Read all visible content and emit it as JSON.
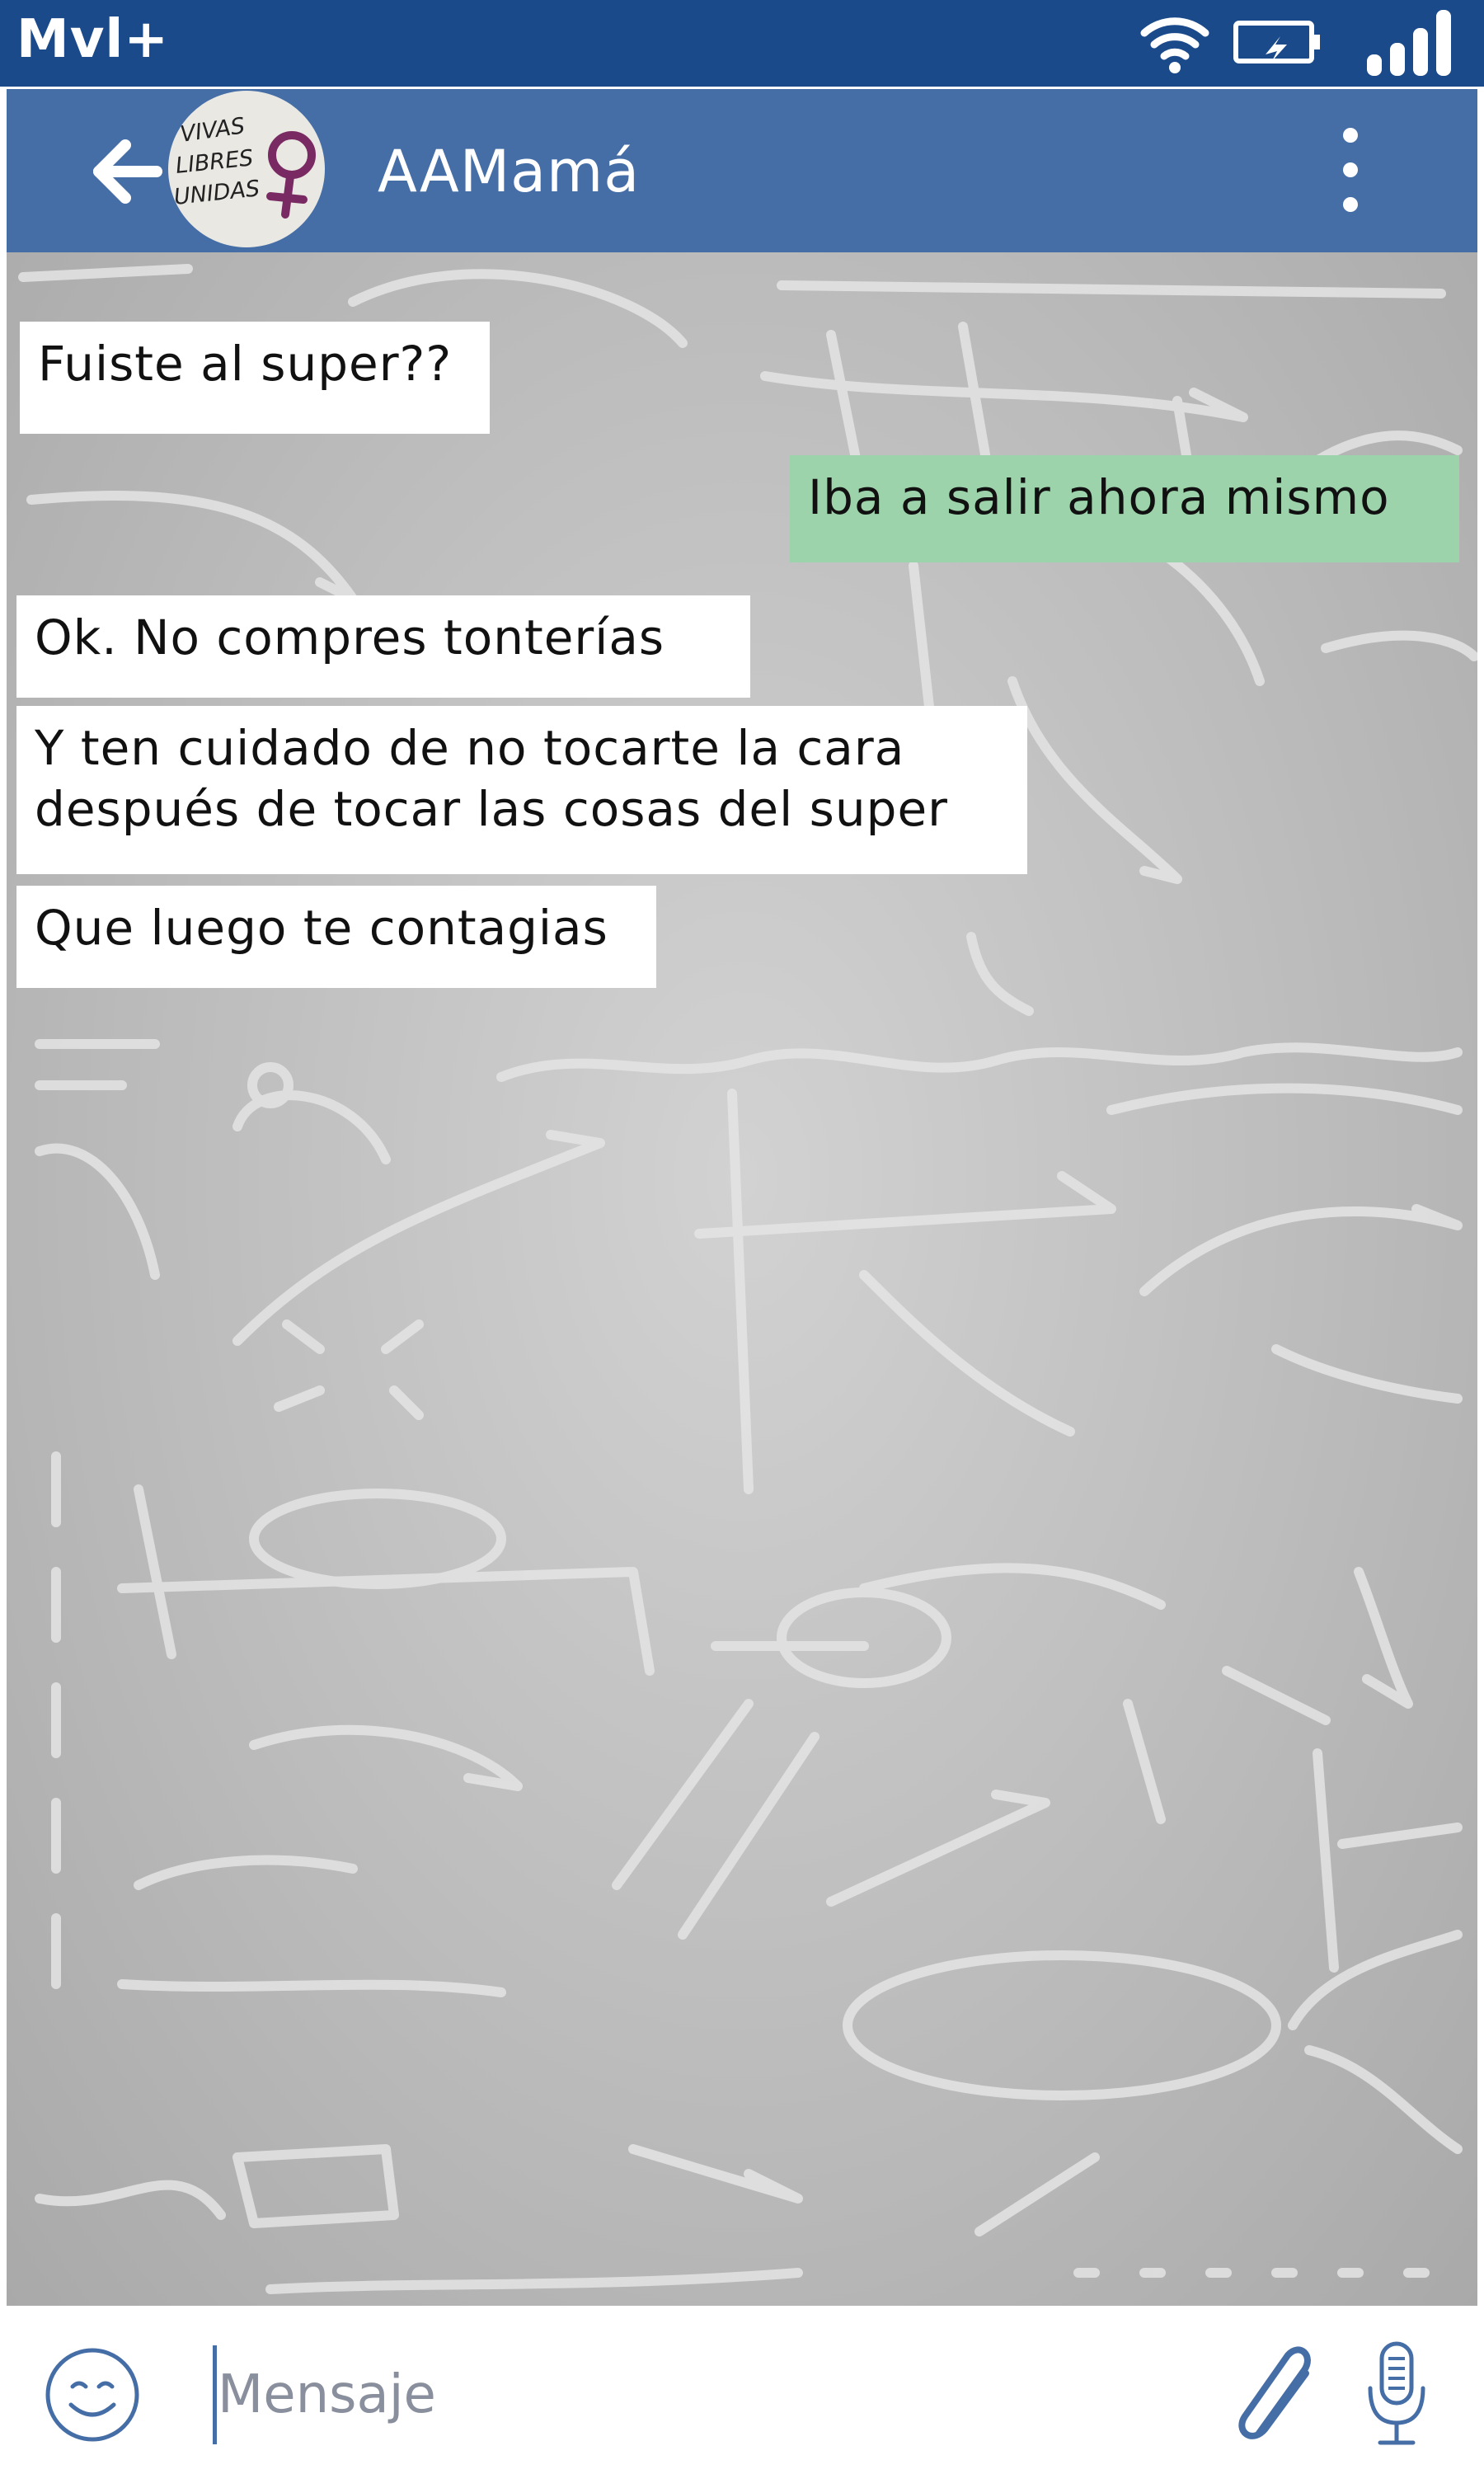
{
  "status_bar": {
    "carrier": "Mvl+",
    "icons": [
      "wifi-icon",
      "battery-charging-icon",
      "signal-icon"
    ]
  },
  "header": {
    "title": "AAMamá",
    "avatar_text": [
      "VIVAS",
      "LIBRES",
      "UNIDAS"
    ],
    "icons": [
      "back-arrow-icon",
      "more-vert-icon"
    ]
  },
  "messages": [
    {
      "direction": "incoming",
      "text": "Fuiste al super??"
    },
    {
      "direction": "outgoing",
      "text": "Iba a salir ahora mismo"
    },
    {
      "direction": "incoming",
      "text": "Ok. No compres tonterías"
    },
    {
      "direction": "incoming",
      "lines": [
        "Y ten cuidado de no tocarte la cara",
        "después de tocar las cosas del super"
      ]
    },
    {
      "direction": "incoming",
      "text": "Que luego te contagias"
    }
  ],
  "composer": {
    "placeholder": "Mensaje",
    "icons": [
      "smiley-icon",
      "paperclip-icon",
      "microphone-icon"
    ]
  },
  "colors": {
    "status_bar": "#1b4a8a",
    "app_bar": "#456da6",
    "incoming_bubble": "#ffffff",
    "outgoing_bubble": "#9dd3aa",
    "avatar_female_symbol": "#7a2a63"
  }
}
